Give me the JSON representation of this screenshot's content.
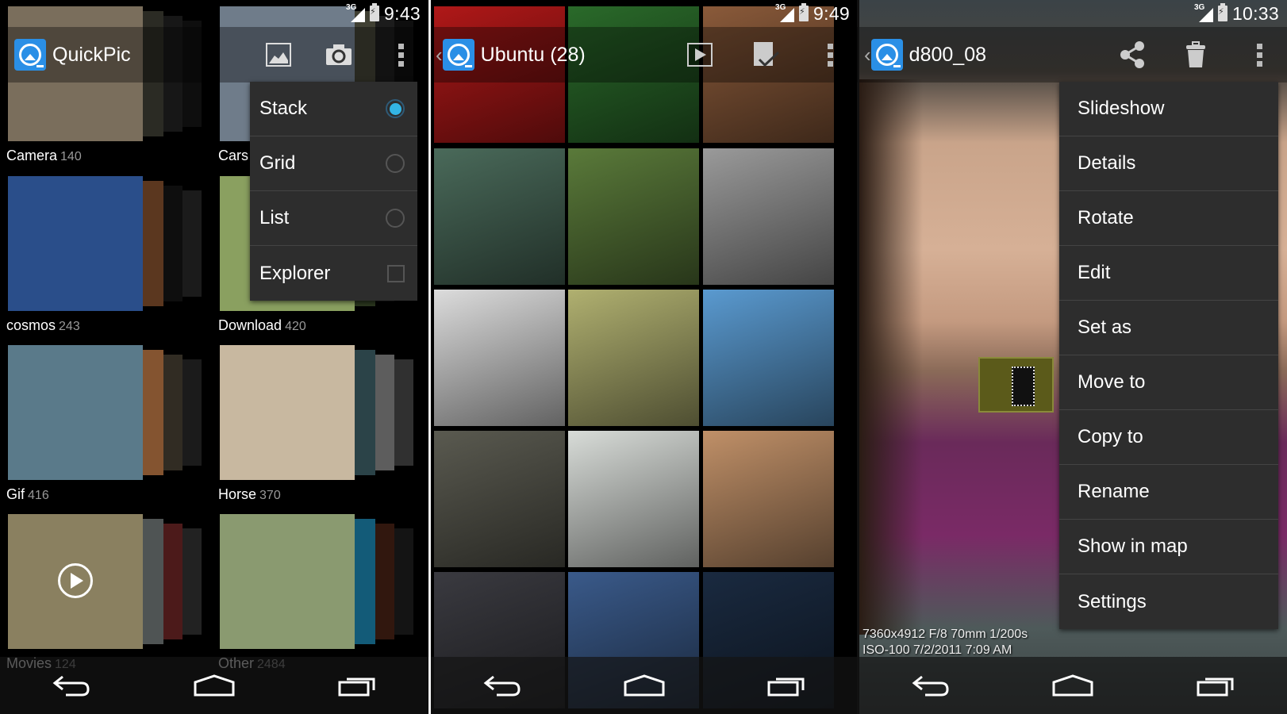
{
  "screens": {
    "albums": {
      "status": {
        "network": "3G",
        "time": "9:43"
      },
      "title": "QuickPic",
      "actions": [
        "gallery-icon",
        "camera-icon",
        "overflow-menu-icon"
      ],
      "albums": [
        {
          "name": "Camera",
          "count": "140",
          "color": "#7a6e5c",
          "c1": "#3a3a30",
          "c2": "#2a2a2a",
          "c3": "#222"
        },
        {
          "name": "Cars",
          "count": "",
          "color": "#6f7c8a",
          "c1": "#554",
          "c2": "#333",
          "c3": "#222"
        },
        {
          "name": "cosmos",
          "count": "243",
          "color": "#2a4e8a",
          "c1": "#7a4a2a",
          "c2": "#1a1a1a",
          "c3": "#444"
        },
        {
          "name": "Download",
          "count": "420",
          "color": "#8aa060",
          "c1": "#3a4a2a",
          "c2": "#222",
          "c3": "#111"
        },
        {
          "name": "Gif",
          "count": "416",
          "color": "#5a7a8a",
          "c1": "#b07040",
          "c2": "#5a5040",
          "c3": "#444"
        },
        {
          "name": "Horse",
          "count": "370",
          "color": "#c8b8a0",
          "c1": "#3a5a60",
          "c2": "#aaa",
          "c3": "#777"
        },
        {
          "name": "Movies",
          "count": "124",
          "color": "#8a8060",
          "c1": "#6a7070",
          "c2": "#8a3030",
          "c3": "#555"
        },
        {
          "name": "Other",
          "count": "2484",
          "color": "#8a9a70",
          "c1": "#1a7aa0",
          "c2": "#5a2a1a",
          "c3": "#333"
        }
      ],
      "view_menu": [
        {
          "label": "Stack",
          "control": "radio",
          "selected": true
        },
        {
          "label": "Grid",
          "control": "radio",
          "selected": false
        },
        {
          "label": "List",
          "control": "radio",
          "selected": false
        },
        {
          "label": "Explorer",
          "control": "checkbox",
          "selected": false
        }
      ]
    },
    "folder": {
      "status": {
        "network": "3G",
        "time": "9:49"
      },
      "title": "Ubuntu (28)",
      "actions": [
        "slideshow-icon",
        "select-icon",
        "overflow-menu-icon"
      ],
      "thumbnails": [
        "#b01818",
        "#2a6a2a",
        "#8a5a3a",
        "#4a6a5a",
        "#5a7a3a",
        "#9a9a9a",
        "#dcdcdc",
        "#b0b070",
        "#5a9ad0",
        "#5a5a50",
        "#d8dcd8",
        "#c09068",
        "#3a3a40",
        "#3a5a8a",
        "#1a2a40"
      ]
    },
    "viewer": {
      "status": {
        "network": "3G",
        "time": "10:33"
      },
      "title": "d800_08",
      "actions": [
        "share-icon",
        "delete-icon",
        "overflow-menu-icon"
      ],
      "exif_line1": "7360x4912 F/8 70mm 1/200s",
      "exif_line2": "ISO-100  7/2/2011 7:09 AM",
      "menu": [
        "Slideshow",
        "Details",
        "Rotate",
        "Edit",
        "Set as",
        "Move to",
        "Copy to",
        "Rename",
        "Show in map",
        "Settings"
      ]
    }
  },
  "colors": {
    "accent": "#33b5e5",
    "menu_bg": "#2d2d2d",
    "logo": "#2a8fe6"
  }
}
